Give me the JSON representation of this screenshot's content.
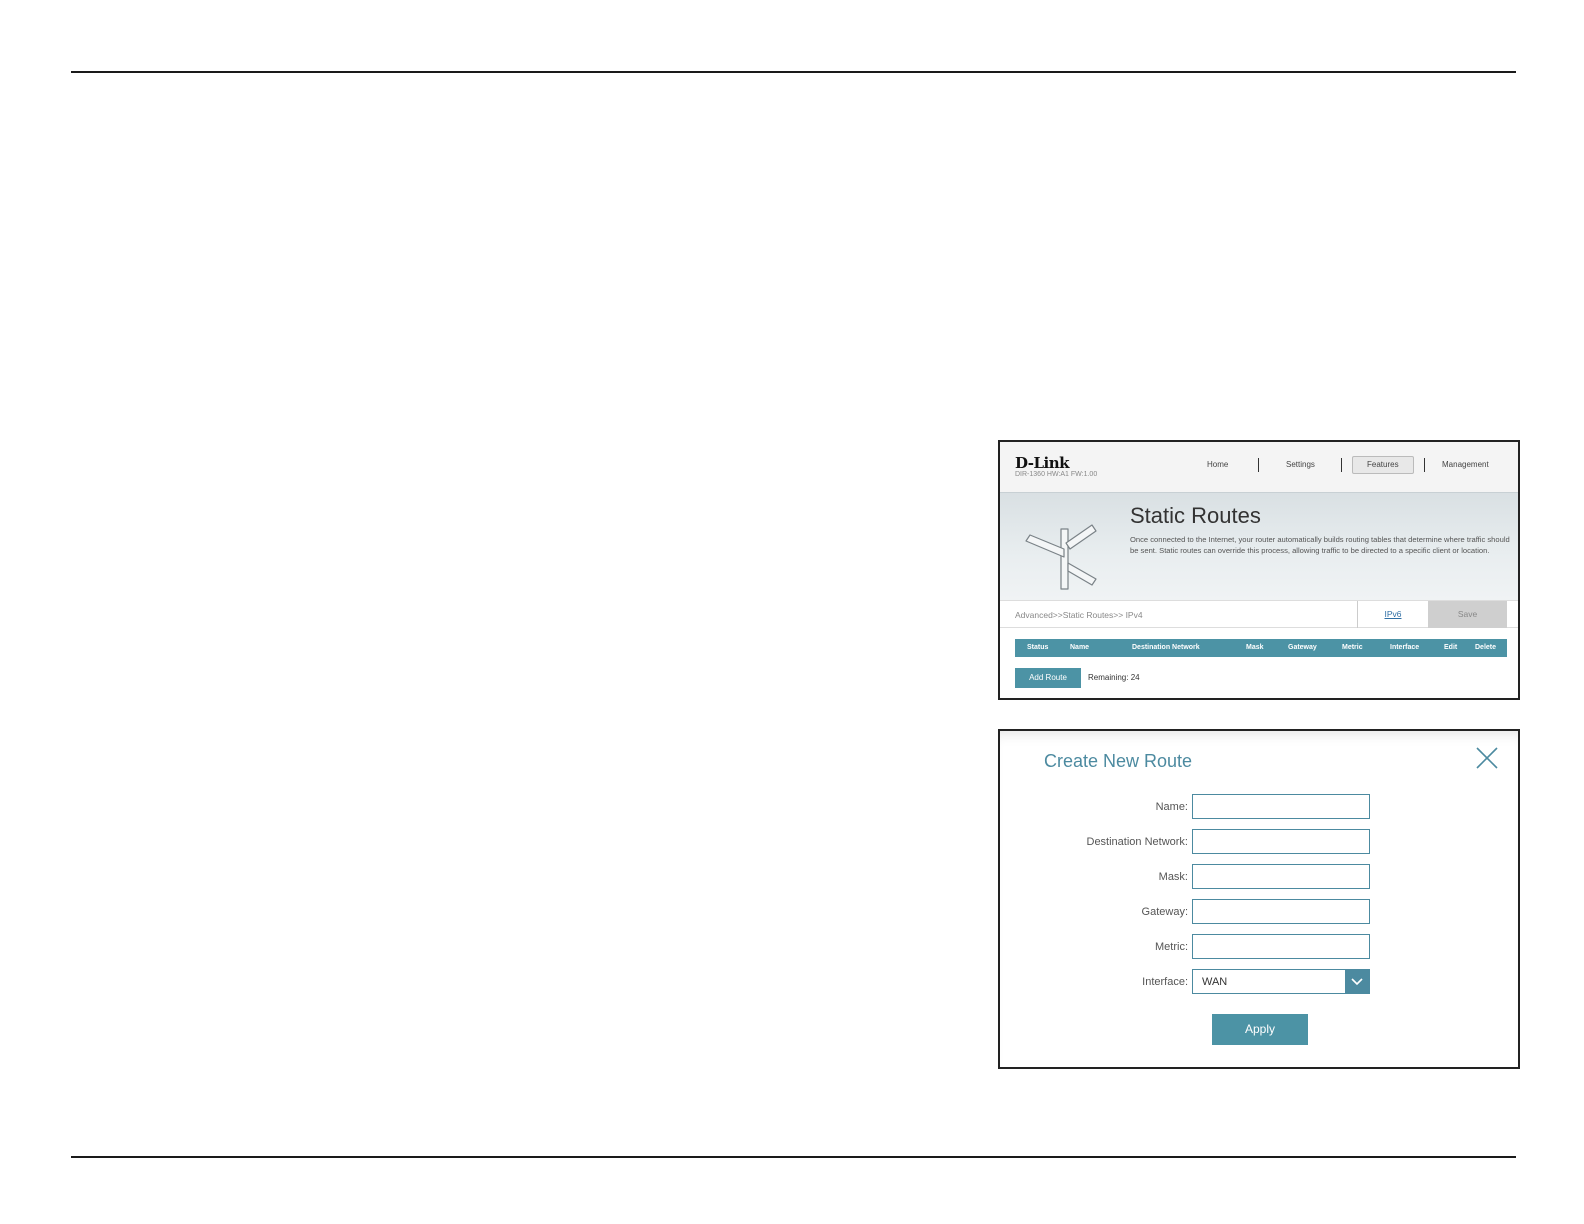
{
  "screenshot1": {
    "logo": "D-Link",
    "model": "DIR-1360 HW:A1 FW:1.00",
    "nav": [
      "Home",
      "Settings",
      "Features",
      "Management"
    ],
    "nav_active": "Features",
    "title": "Static Routes",
    "description": "Once connected to the Internet, your router automatically builds routing tables that determine where traffic should be sent. Static routes can override this process, allowing traffic to be directed to a specific client or location.",
    "breadcrumb": "Advanced>>Static Routes>> IPv4",
    "ipv6_link": "IPv6",
    "save_label": "Save",
    "table_headers": [
      "Status",
      "Name",
      "Destination Network",
      "Mask",
      "Gateway",
      "Metric",
      "Interface",
      "Edit",
      "Delete"
    ],
    "add_route_label": "Add Route",
    "remaining_text": "Remaining: 24",
    "colors": {
      "accent": "#4c93a5",
      "link": "#2f6fa5"
    }
  },
  "screenshot2": {
    "title": "Create New Route",
    "fields": [
      {
        "label": "Name:",
        "value": ""
      },
      {
        "label": "Destination Network:",
        "value": ""
      },
      {
        "label": "Mask:",
        "value": ""
      },
      {
        "label": "Gateway:",
        "value": ""
      },
      {
        "label": "Metric:",
        "value": ""
      }
    ],
    "interface_label": "Interface:",
    "interface_value": "WAN",
    "apply_label": "Apply",
    "icons": {
      "close": "close-icon",
      "dropdown": "chevron-down-icon"
    },
    "colors": {
      "accent": "#4c8aa0"
    }
  }
}
